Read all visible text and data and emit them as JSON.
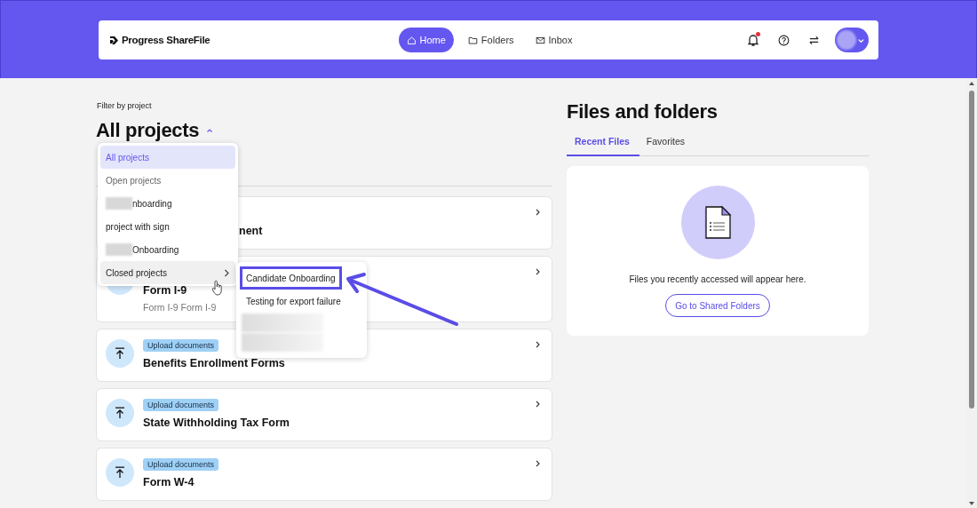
{
  "header": {
    "logo": "Progress ShareFile",
    "has_unread_notifications": true,
    "nav": [
      {
        "label": "Home",
        "selected": true
      },
      {
        "label": "Folders",
        "selected": false
      },
      {
        "label": "Inbox",
        "selected": false
      }
    ]
  },
  "projects": {
    "filter_label": "Filter by project",
    "title": "All projects",
    "menu_open": true,
    "menu": [
      {
        "kind": "option",
        "label": "All projects",
        "selected": true
      },
      {
        "kind": "heading",
        "label": "Open projects"
      },
      {
        "kind": "option",
        "label": "nboarding",
        "redacted": true,
        "selected": false
      },
      {
        "kind": "option",
        "label": "project with sign",
        "redacted": false,
        "selected": false
      },
      {
        "kind": "option",
        "label": "Onboarding",
        "redacted": true,
        "selected": false
      },
      {
        "kind": "submenu",
        "label": "Closed projects",
        "hovered": true
      }
    ],
    "submenu": [
      {
        "kind": "option",
        "label": "Candidate Onboarding",
        "highlighted": true
      },
      {
        "kind": "option",
        "label": "Testing for export failure",
        "highlighted": false
      },
      {
        "kind": "redacted"
      },
      {
        "kind": "redacted"
      }
    ],
    "cards": [
      {
        "kind": "clipped",
        "title": "nent"
      },
      {
        "kind": "task",
        "title": "Form I-9",
        "subtitle": "Form I-9 Form I-9"
      },
      {
        "kind": "task",
        "badge": "Upload documents",
        "title": "Benefits Enrollment Forms"
      },
      {
        "kind": "task",
        "badge": "Upload documents",
        "title": "State Withholding Tax Form"
      },
      {
        "kind": "task",
        "badge": "Upload documents",
        "title": "Form W-4"
      }
    ]
  },
  "files": {
    "title": "Files and folders",
    "tabs": [
      {
        "label": "Recent Files",
        "selected": true
      },
      {
        "label": "Favorites",
        "selected": false
      }
    ],
    "empty_text": "Files you recently accessed will appear here.",
    "button": "Go to Shared Folders"
  }
}
